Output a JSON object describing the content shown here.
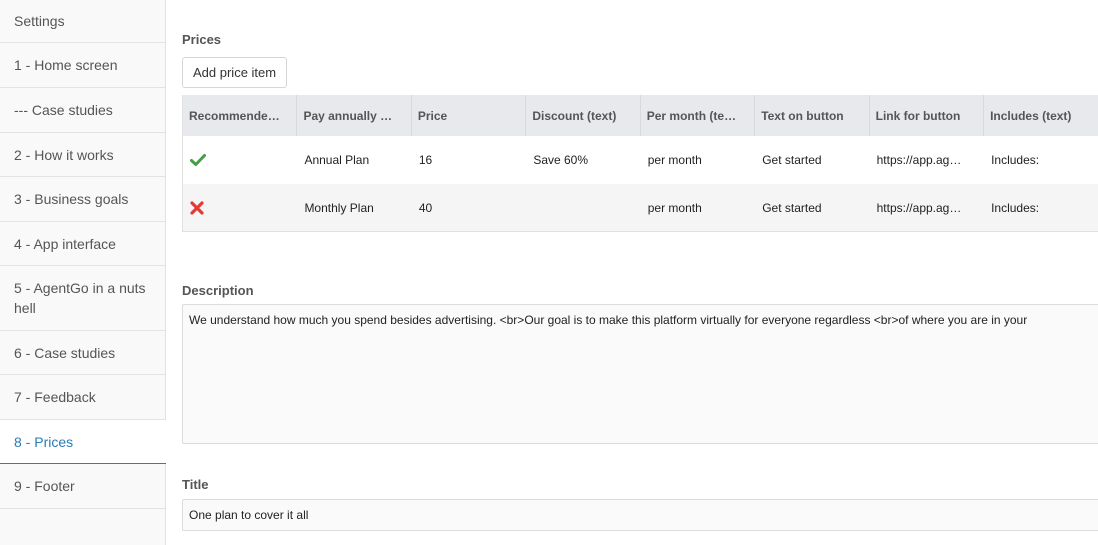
{
  "sidebar": {
    "items": [
      {
        "label": "Settings"
      },
      {
        "label": "1 - Home screen"
      },
      {
        "label": "--- Case studies"
      },
      {
        "label": "2 - How it works"
      },
      {
        "label": "3 - Business goals"
      },
      {
        "label": "4 - App interface"
      },
      {
        "label": "5 - AgentGo in a nuts hell"
      },
      {
        "label": "6 - Case studies"
      },
      {
        "label": "7 - Feedback"
      },
      {
        "label": "8 - Prices",
        "active": true
      },
      {
        "label": "9 - Footer"
      }
    ]
  },
  "prices": {
    "label": "Prices",
    "add_button": "Add price item",
    "columns": [
      "Recommende…",
      "Pay annually …",
      "Price",
      "Discount (text)",
      "Per month (te…",
      "Text on button",
      "Link for button",
      "Includes (text)"
    ],
    "rows": [
      {
        "recommended": "check-icon",
        "pay": "Annual Plan",
        "price": "16",
        "discount": "Save 60%",
        "per_month": "per month",
        "button_text": "Get started",
        "link": "https://app.ag…",
        "includes": "Includes:"
      },
      {
        "recommended": "cross-icon",
        "pay": "Monthly Plan",
        "price": "40",
        "discount": "",
        "per_month": "per month",
        "button_text": "Get started",
        "link": "https://app.ag…",
        "includes": "Includes:"
      }
    ]
  },
  "description": {
    "label": "Description",
    "value": "We understand how much you spend besides advertising. <br>Our goal is to make this platform virtually for everyone regardless <br>of where you are in your"
  },
  "title": {
    "label": "Title",
    "value": "One plan to cover it all"
  },
  "colors": {
    "accent": "#2a7db8",
    "check": "#4caf50",
    "cross": "#e53935"
  }
}
